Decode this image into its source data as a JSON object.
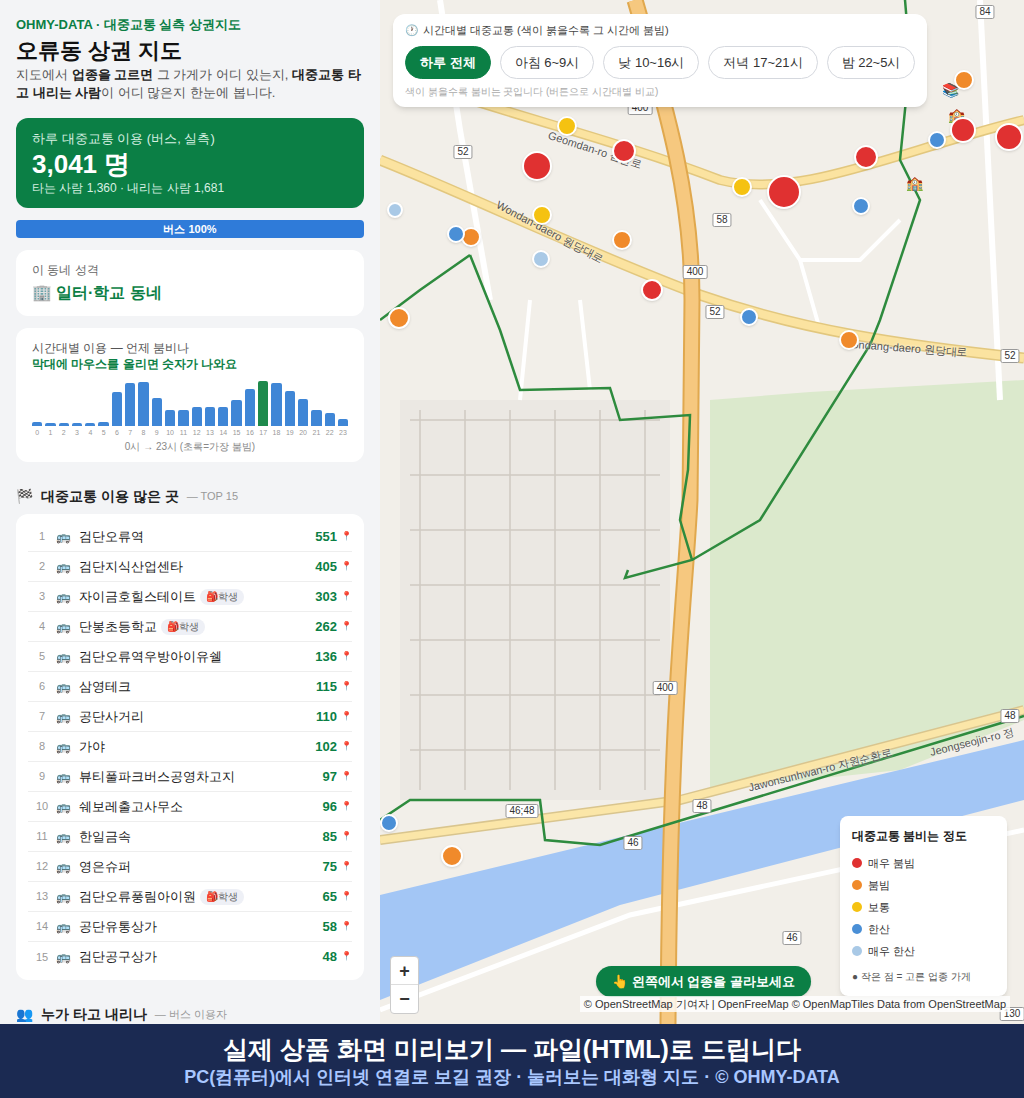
{
  "brand": "OHMY-DATA · 대중교통 실측 상권지도",
  "title": "오류동 상권 지도",
  "intro": [
    {
      "text": "지도에서 ",
      "bold": false
    },
    {
      "text": "업종을 고르면",
      "bold": true
    },
    {
      "text": " 그 가게가 어디 있는지, ",
      "bold": false
    },
    {
      "text": "대중교통 타고 내리는 사람",
      "bold": true
    },
    {
      "text": "이 어디 많은지 한눈에 봅니다.",
      "bold": false
    }
  ],
  "summary": {
    "label": "하루 대중교통 이용 (버스, 실측)",
    "total": "3,041",
    "unit": "명",
    "detail": "타는 사람 1,360 · 내리는 사람 1,681"
  },
  "mode_bar": {
    "label": "버스 100%",
    "level": 1
  },
  "character": {
    "label": "이 동네 성격",
    "icon": "🏢",
    "value": "일터·학교 동네"
  },
  "hourly": {
    "title": "시간대별 이용 — 언제 붐비나",
    "hint": "막대에 마우스를 올리면 숫자가 나와요",
    "values": [
      18,
      12,
      12,
      12,
      12,
      18,
      204,
      262,
      268,
      166,
      96,
      96,
      114,
      114,
      114,
      156,
      226,
      275,
      262,
      210,
      160,
      96,
      72,
      36
    ],
    "highlight_index": 17,
    "ticks": [
      "0",
      "1",
      "2",
      "3",
      "4",
      "5",
      "6",
      "7",
      "8",
      "9",
      "10",
      "11",
      "12",
      "13",
      "14",
      "15",
      "16",
      "17",
      "18",
      "19",
      "20",
      "21",
      "22",
      "23"
    ],
    "caption": "0시 → 23시 (초록=가장 붐빔)"
  },
  "top": {
    "icon": "🏁",
    "title": "대중교통 이용 많은 곳",
    "sub": "— TOP 15",
    "rows": [
      {
        "rank": "1",
        "icon": "🚌",
        "name": "검단오류역",
        "count": "551",
        "pin": "📍"
      },
      {
        "rank": "2",
        "icon": "🚌",
        "name": "검단지식산업센타",
        "count": "405",
        "pin": "📍"
      },
      {
        "rank": "3",
        "icon": "🚌",
        "name": "자이금호힐스테이트",
        "badge": {
          "icon": "🎒",
          "label": "학생"
        },
        "count": "303",
        "pin": "📍"
      },
      {
        "rank": "4",
        "icon": "🚌",
        "name": "단봉초등학교",
        "badge": {
          "icon": "🎒",
          "label": "학생"
        },
        "count": "262",
        "pin": "📍"
      },
      {
        "rank": "5",
        "icon": "🚌",
        "name": "검단오류역우방아이유쉘",
        "count": "136",
        "pin": "📍"
      },
      {
        "rank": "6",
        "icon": "🚌",
        "name": "삼영테크",
        "count": "115",
        "pin": "📍"
      },
      {
        "rank": "7",
        "icon": "🚌",
        "name": "공단사거리",
        "count": "110",
        "pin": "📍"
      },
      {
        "rank": "8",
        "icon": "🚌",
        "name": "가야",
        "count": "102",
        "pin": "📍"
      },
      {
        "rank": "9",
        "icon": "🚌",
        "name": "뷰티풀파크버스공영차고지",
        "count": "97",
        "pin": "📍"
      },
      {
        "rank": "10",
        "icon": "🚌",
        "name": "쉐보레출고사무소",
        "count": "96",
        "pin": "📍"
      },
      {
        "rank": "11",
        "icon": "🚌",
        "name": "한일금속",
        "count": "85",
        "pin": "📍"
      },
      {
        "rank": "12",
        "icon": "🚌",
        "name": "영은슈퍼",
        "count": "75",
        "pin": "📍"
      },
      {
        "rank": "13",
        "icon": "🚌",
        "name": "검단오류풍림아이원",
        "badge": {
          "icon": "🎒",
          "label": "학생"
        },
        "count": "65",
        "pin": "📍"
      },
      {
        "rank": "14",
        "icon": "🚌",
        "name": "공단유통상가",
        "count": "58",
        "pin": "📍"
      },
      {
        "rank": "15",
        "icon": "🚌",
        "name": "검단공구상가",
        "count": "48",
        "pin": "📍"
      }
    ]
  },
  "riders": {
    "icon": "👥",
    "title": "누가 타고 내리나",
    "sub": "— 버스 이용자"
  },
  "time_filter": {
    "icon": "🕐",
    "title": "시간대별 대중교통 (색이 붉을수록 그 시간에 붐빔)",
    "buttons": [
      {
        "label": "하루 전체",
        "selected": true
      },
      {
        "label": "아침 6~9시",
        "selected": false
      },
      {
        "label": "낮 10~16시",
        "selected": false
      },
      {
        "label": "저녁 17~21시",
        "selected": false
      },
      {
        "label": "밤 22~5시",
        "selected": false
      }
    ],
    "hint": "색이 붉을수록 붐비는 곳입니다 (버튼으로 시간대별 비교)"
  },
  "map": {
    "markers": [
      {
        "color": "#e03131"
      },
      {
        "color": "#e03131"
      },
      {
        "color": "#f5c211"
      },
      {
        "color": "#e03131"
      },
      {
        "color": "#f5c211"
      },
      {
        "color": "#e03131"
      },
      {
        "color": "#4a8fd6"
      },
      {
        "color": "#f08a2b"
      },
      {
        "color": "#4a8fd6"
      },
      {
        "color": "#e03131"
      },
      {
        "color": "#e03131"
      },
      {
        "color": "#f5c211"
      },
      {
        "color": "#f08a2b"
      },
      {
        "color": "#4a8fd6"
      },
      {
        "color": "#f08a2b"
      },
      {
        "color": "#a9c9e6"
      },
      {
        "color": "#e03131"
      },
      {
        "color": "#4a8fd6"
      },
      {
        "color": "#f08a2b"
      },
      {
        "color": "#f08a2b"
      },
      {
        "color": "#a9c9e6"
      },
      {
        "color": "#4a8fd6"
      },
      {
        "color": "#f08a2b"
      }
    ],
    "pois": [
      "📚",
      "🏫",
      "🏫"
    ],
    "road_labels": [
      "Geomdan-ro 검단로",
      "Wondan-daero 원당대로",
      "Wondang-daero 원당대로",
      "Jawonsunhwan-ro 자원순환로",
      "Jeongseojin-ro 정"
    ],
    "shields": [
      "400",
      "400",
      "400",
      "52",
      "52",
      "52",
      "58",
      "84",
      "46;48",
      "48",
      "46",
      "46",
      "48",
      "130"
    ]
  },
  "legend": {
    "title": "대중교통 붐비는 정도",
    "items": [
      {
        "label": "매우 붐빔",
        "color": "#e03131"
      },
      {
        "label": "붐빔",
        "color": "#f08a2b"
      },
      {
        "label": "보통",
        "color": "#f5c211"
      },
      {
        "label": "한산",
        "color": "#4a8fd6"
      },
      {
        "label": "매우 한산",
        "color": "#a9c9e6"
      }
    ],
    "note": "● 작은 점 = 고른 업종 가게"
  },
  "zoom": [
    "+",
    "−"
  ],
  "cta": "👆 왼쪽에서 업종을 골라보세요",
  "attribution": "© OpenStreetMap 기여자 | OpenFreeMap © OpenMapTiles Data from OpenStreetMap",
  "banner": {
    "title": "실제 상품 화면 미리보기 — 파일(HTML)로 드립니다",
    "subtitle": "PC(컴퓨터)에서 인터넷 연결로 보길 권장 · 눌러보는 대화형 지도 · © OHMY-DATA"
  }
}
